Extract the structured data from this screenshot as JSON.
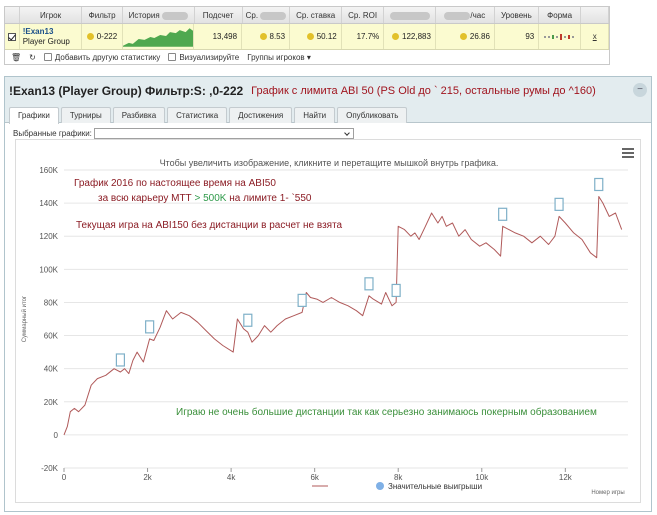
{
  "stats_table": {
    "headers": [
      "",
      "Игрок",
      "Фильтр",
      "История",
      "Подсчет",
      "Ср.",
      "Ср. ставка",
      "Ср. ROI",
      "",
      "/час",
      "Уровень",
      "Форма"
    ],
    "row": {
      "player_name": "!Exan13",
      "player_group": "Player Group",
      "filter": "0-222",
      "count": "13,498",
      "avg": "8.53",
      "avg_stake": "50.12",
      "avg_roi": "17.7%",
      "profit": "122,883",
      "per_hour": "26.86",
      "level": "93",
      "form_link": "x"
    },
    "toolbar": {
      "add_stats": "Добавить другую статистику",
      "visualize": "Визуализируйте",
      "player_groups": "Группы игроков"
    }
  },
  "panel": {
    "title": "!Exan13 (Player Group) Фильтр:S:  ,0-222",
    "note": "График с лимита ABI 50 (PS Old до ` 215, остальные румы до ^160)",
    "close": "−",
    "tabs": [
      "Графики",
      "Турниры",
      "Разбивка",
      "Статистика",
      "Достижения",
      "Найти",
      "Опубликовать"
    ],
    "select_label": "Выбранные графики:",
    "select_value": ""
  },
  "chart": {
    "hint": "Чтобы увеличить изображение, кликните и перетащите мышкой внутрь графика.",
    "ann1": "График 2016 по настоящее время на ABI50",
    "ann2_pre": "за всю карьеру МТТ ",
    "ann2_green": ">  500K",
    "ann2_post": " на лимите   1- `550",
    "ann3": "Текущая игра на ABI150 без дистанции в расчет не взята",
    "ann4": "Играю не очень большие дистанции так как серьезно занимаюсь покерным образованием",
    "legend": "Значительные выигрыши",
    "y_axis_label": "Суммарный итог",
    "x_axis_label": "Номер игры",
    "colors": {
      "line": "#b05a5a",
      "marker": "#7fb0c8",
      "legend_dot": "#7fb0e6"
    }
  },
  "chart_data": {
    "type": "line",
    "xlabel": "Номер игры",
    "ylabel": "Суммарный итог",
    "xlim": [
      0,
      13500
    ],
    "ylim": [
      -20000,
      160000
    ],
    "x_ticks": [
      "0",
      "2k",
      "4k",
      "6k",
      "8k",
      "10k",
      "12k"
    ],
    "y_ticks": [
      "-20K",
      "0",
      "20K",
      "40K",
      "60K",
      "80K",
      "100K",
      "120K",
      "140K",
      "160K"
    ],
    "series": [
      {
        "x": [
          0,
          80,
          150,
          250,
          350,
          500,
          650,
          800,
          1000,
          1200,
          1350,
          1450,
          1550,
          1650,
          1750,
          1900,
          2050,
          2150,
          2300,
          2450,
          2600,
          2800,
          3000,
          3200,
          3400,
          3600,
          3800,
          4050,
          4150,
          4300,
          4400,
          4500,
          4650,
          4800,
          4950,
          5100,
          5300,
          5500,
          5700,
          5800,
          5900,
          6050,
          6200,
          6400,
          6600,
          6800,
          7000,
          7150,
          7300,
          7400,
          7600,
          7700,
          7850,
          7950,
          8000,
          8150,
          8300,
          8400,
          8500,
          8650,
          8800,
          8950,
          9050,
          9150,
          9300,
          9450,
          9600,
          9750,
          9950,
          10100,
          10300,
          10450,
          10500,
          10650,
          10800,
          11000,
          11200,
          11400,
          11600,
          11750,
          11850,
          12000,
          12200,
          12400,
          12600,
          12750,
          12800,
          12900,
          13050,
          13200,
          13350
        ],
        "y": [
          0,
          5000,
          14000,
          16000,
          14000,
          18000,
          30000,
          34000,
          36000,
          40000,
          38000,
          40000,
          37000,
          45000,
          50000,
          44000,
          58000,
          57000,
          65000,
          75000,
          70000,
          74000,
          72000,
          68000,
          63000,
          58000,
          54000,
          50000,
          70000,
          64000,
          62000,
          56000,
          60000,
          66000,
          62000,
          66000,
          70000,
          72000,
          74000,
          86000,
          83000,
          82000,
          80000,
          83000,
          80000,
          78000,
          75000,
          72000,
          84000,
          82000,
          79000,
          86000,
          78000,
          80000,
          126000,
          124000,
          120000,
          122000,
          118000,
          126000,
          134000,
          128000,
          132000,
          126000,
          128000,
          120000,
          124000,
          118000,
          114000,
          116000,
          112000,
          108000,
          126000,
          124000,
          122000,
          120000,
          116000,
          120000,
          115000,
          120000,
          132000,
          128000,
          122000,
          118000,
          110000,
          107000,
          144000,
          140000,
          132000,
          134000,
          124000
        ]
      }
    ],
    "significant_wins_x": [
      1350,
      2050,
      4400,
      5700,
      7300,
      7950,
      10500,
      11850,
      12800
    ]
  }
}
